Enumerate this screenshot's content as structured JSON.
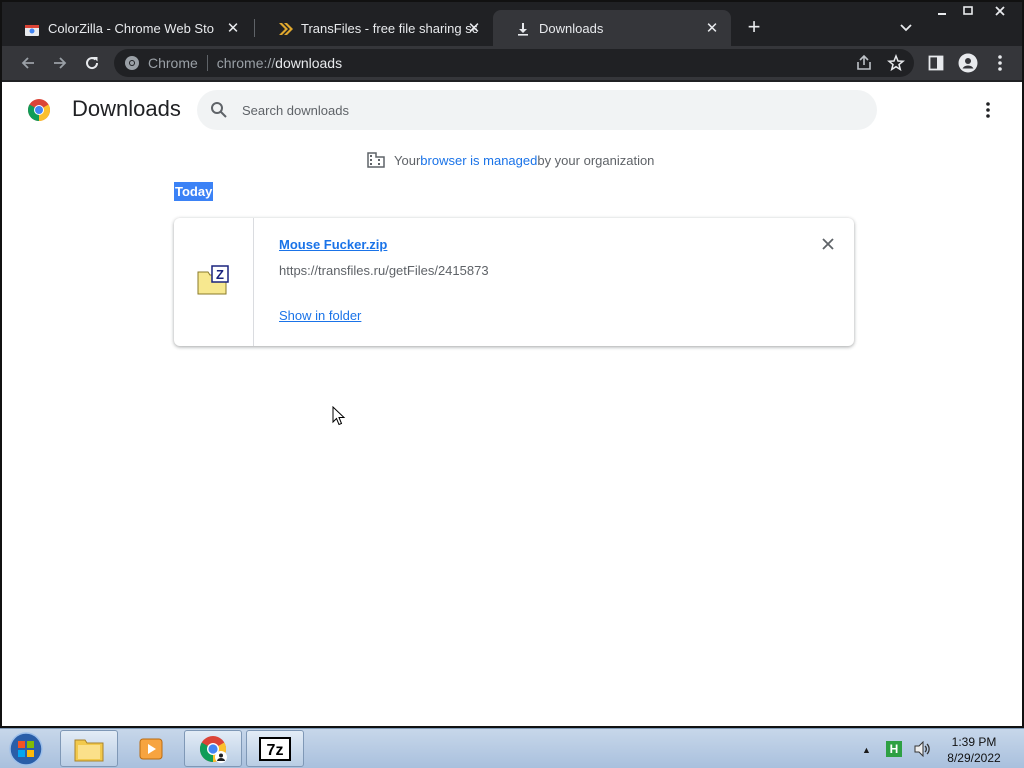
{
  "tabs": [
    {
      "title": "ColorZilla - Chrome Web Store",
      "icon": "chrome-web-store-icon",
      "active": false
    },
    {
      "title": "TransFiles - free file sharing servi",
      "icon": "transfiles-icon",
      "active": false
    },
    {
      "title": "Downloads",
      "icon": "download-icon",
      "active": true
    }
  ],
  "toolbar": {
    "site_label": "Chrome",
    "url_prefix": "chrome://",
    "url_host": "downloads"
  },
  "page": {
    "title": "Downloads",
    "search_placeholder": "Search downloads",
    "managed": {
      "before": "Your ",
      "link": "browser is managed",
      "after": " by your organization"
    },
    "section_label": "Today",
    "download": {
      "filename": "Mouse Fucker.zip",
      "url": "https://transfiles.ru/getFiles/2415873",
      "action": "Show in folder"
    }
  },
  "taskbar": {
    "apps": [
      "file-explorer",
      "media-player",
      "chrome",
      "7zip"
    ],
    "time": "1:39 PM",
    "date": "8/29/2022"
  },
  "colors": {
    "accent": "#1a73e8",
    "tab_bar": "#202124",
    "toolbar": "#35363a",
    "selection": "#3b82f6"
  }
}
